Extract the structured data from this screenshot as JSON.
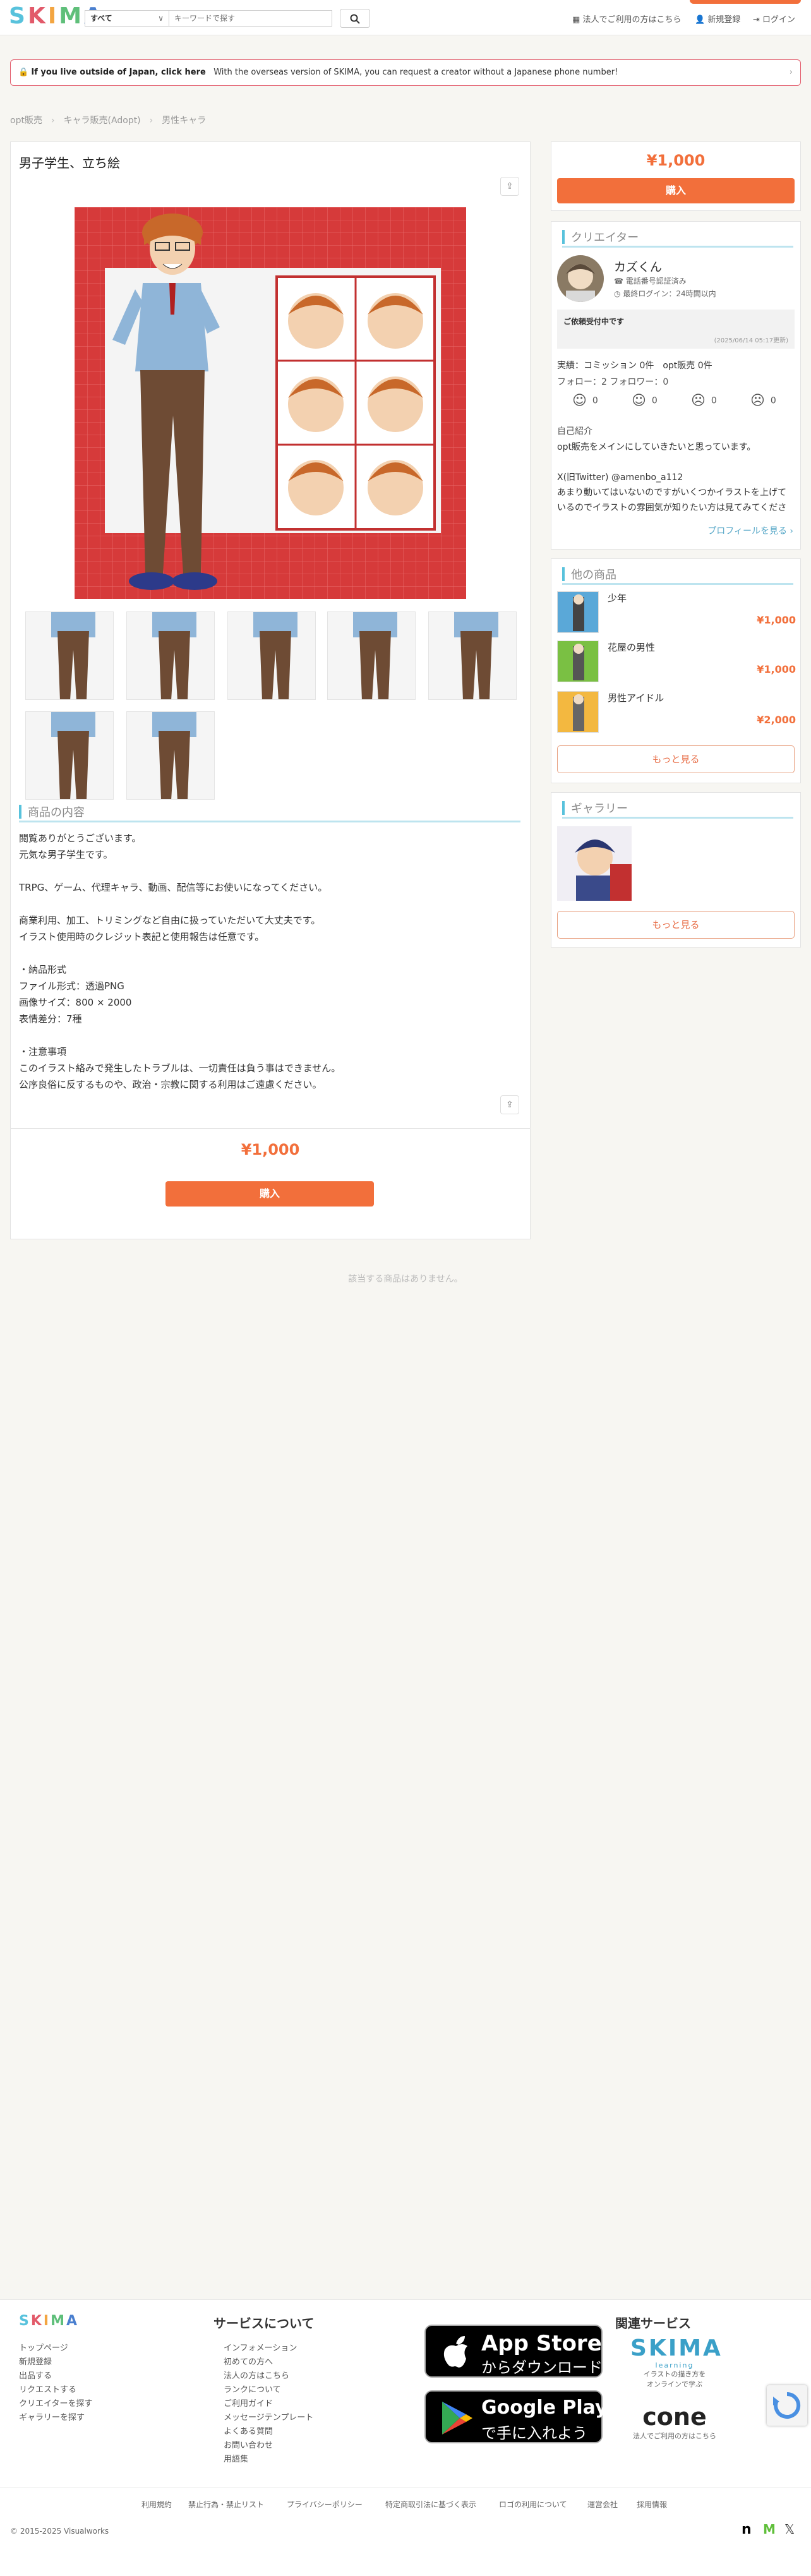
{
  "header": {
    "logo": "SKIMA",
    "logo_colors": [
      "#f3a541",
      "#e25a6a",
      "#58c2dc",
      "#4a7fcf",
      "#5fbf7a"
    ],
    "search": {
      "category": "すべて",
      "placeholder": "キーワードで探す"
    },
    "links": {
      "corporate": "法人でご利用の方はこちら",
      "register": "新規登録",
      "login": "ログイン"
    }
  },
  "banner": {
    "strong": "If you live outside of Japan, click here",
    "text": "With the overseas version of SKIMA, you can request a creator without a Japanese phone number!"
  },
  "breadcrumb": [
    "opt販売",
    "キャラ販売(Adopt)",
    "男性キャラ"
  ],
  "item": {
    "title": "男子学生、立ち絵",
    "description": "閲覧ありがとうございます。\n元気な男子学生です。\n\nTRPG、ゲーム、代理キャラ、動画、配信等にお使いになってください。\n\n商業利用、加工、トリミングなど自由に扱っていただいて大丈夫です。\nイラスト使用時のクレジット表記と使用報告は任意です。\n\n・納品形式\nファイル形式：透過PNG\n画像サイズ：800 × 2000\n表情差分：7種\n\n・注意事項\nこのイラスト絡みで発生したトラブルは、一切責任は負う事はできません。\n公序良俗に反するものや、政治・宗教に関する利用はご遠慮ください。",
    "section_title": "商品の内容",
    "price": "¥1,000",
    "buy_label": "購入",
    "no_other": "該当する商品はありません。"
  },
  "sidebar": {
    "price": "¥1,000",
    "buy_label": "購入",
    "creator": {
      "section_title": "クリエイター",
      "name": "カズくん",
      "verified": "電話番号認証済み",
      "last_login": "最終ログイン：24時間以内",
      "status": "ご依頼受付中です",
      "status_date": "(2025/06/14 05:17更新)",
      "stats": "実績：コミッション 0件　opt販売 0件",
      "follow": "フォロー：2 フォロワー：0",
      "ratings": [
        "0",
        "0",
        "0",
        "0"
      ],
      "intro_label": "自己紹介",
      "intro": "opt販売をメインにしていきたいと思っています。\n\nX(旧Twitter) @amenbo_a112\nあまり動いてはいないのですがいくつかイラストを上げているのでイラストの雰囲気が知りたい方は見てみてください。",
      "profile_link": "プロフィールを見る ›"
    },
    "other_products": {
      "section_title": "他の商品",
      "items": [
        {
          "name": "少年",
          "price": "¥1,000"
        },
        {
          "name": "花屋の男性",
          "price": "¥1,000"
        },
        {
          "name": "男性アイドル",
          "price": "¥2,000"
        }
      ],
      "more": "もっと見る"
    },
    "gallery": {
      "section_title": "ギャラリー",
      "more": "もっと見る"
    }
  },
  "footer": {
    "logo": "SKIMA",
    "col1": [
      "トップページ",
      "新規登録",
      "出品する",
      "リクエストする",
      "クリエイターを探す",
      "ギャラリーを探す"
    ],
    "service_title": "サービスについて",
    "col2": [
      "インフォメーション",
      "初めての方へ",
      "法人の方はこちら",
      "ランクについて",
      "ご利用ガイド",
      "メッセージテンプレート",
      "よくある質問",
      "お問い合わせ",
      "用語集"
    ],
    "app_store": {
      "line1": "App Store",
      "line2": "からダウンロード"
    },
    "google_play": {
      "line1": "Google Play",
      "line2": "で手に入れよう"
    },
    "related_title": "関連サービス",
    "related": [
      {
        "name": "SKIMA",
        "sub": "learning",
        "desc": "イラストの描き方を\nオンラインで学ぶ"
      },
      {
        "name": "cone",
        "desc": "法人でご利用の方はこちら"
      }
    ],
    "bottom_links": [
      "利用規約",
      "禁止行為・禁止リスト",
      "プライバシーポリシー",
      "特定商取引法に基づく表示",
      "ロゴの利用について",
      "運営会社",
      "採用情報"
    ],
    "copyright": "© 2015-2025 Visualworks"
  }
}
